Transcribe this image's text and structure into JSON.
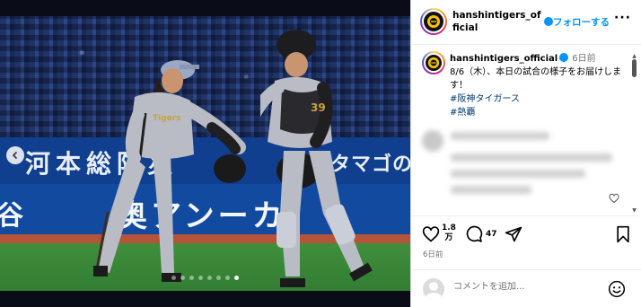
{
  "media": {
    "banner_left": "河本総防災",
    "banner_right": "タマゴの",
    "wall_text": "奥アンーカ",
    "wall_left": "谷",
    "slides": 8,
    "active_slide": 7
  },
  "header": {
    "username": "hanshintigers_official",
    "follow_label": "フォローする",
    "more_label": "···"
  },
  "caption": {
    "username": "hanshintigers_official",
    "time": "6日前",
    "text": "8/6（木）、本日の試合の様子をお届けします！",
    "hashtags": [
      "#阪神タイガース",
      "#熱覇"
    ]
  },
  "actions": {
    "likes": "1.8万",
    "likes_top": "1.8",
    "likes_bottom": "万",
    "comments": "47",
    "date": "6日前"
  },
  "comment_bar": {
    "placeholder": "コメントを追加..."
  },
  "colors": {
    "accent": "#0095f6",
    "hashtag": "#00376b",
    "muted": "#737373"
  },
  "icons": [
    "chevron-left-icon",
    "verified-icon",
    "heart-icon",
    "comment-icon",
    "share-icon",
    "bookmark-icon",
    "smile-icon",
    "tigers-logo-icon"
  ]
}
